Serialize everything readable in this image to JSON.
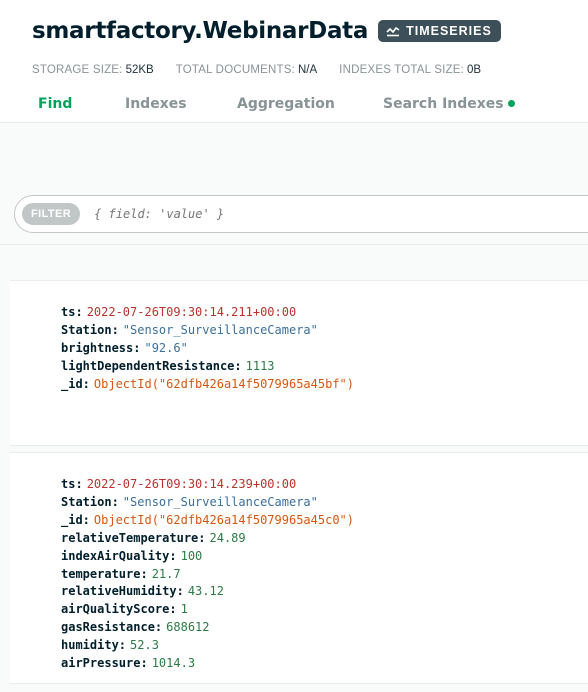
{
  "header": {
    "namespace": "smartfactory.WebinarData",
    "badge": "TIMESERIES",
    "stats": [
      {
        "label": "STORAGE SIZE:",
        "value": "52KB"
      },
      {
        "label": "TOTAL DOCUMENTS:",
        "value": "N/A"
      },
      {
        "label": "INDEXES TOTAL SIZE:",
        "value": "0B"
      }
    ]
  },
  "tabs": [
    {
      "label": "Find",
      "active": true
    },
    {
      "label": "Indexes"
    },
    {
      "label": "Aggregation"
    },
    {
      "label": "Search Indexes"
    }
  ],
  "query": {
    "filter_label": "FILTER",
    "placeholder": "{ field: 'value' }"
  },
  "documents": [
    {
      "fields": [
        {
          "key": "ts:",
          "value": "2022-07-26T09:30:14.211+00:00",
          "type": "date"
        },
        {
          "key": "Station:",
          "value": "\"Sensor_SurveillanceCamera\"",
          "type": "string"
        },
        {
          "key": "brightness:",
          "value": "\"92.6\"",
          "type": "string"
        },
        {
          "key": "lightDependentResistance:",
          "value": "1113",
          "type": "number"
        },
        {
          "key": "_id:",
          "value": "ObjectId(\"62dfb426a14f5079965a45bf\")",
          "type": "objectid"
        }
      ]
    },
    {
      "fields": [
        {
          "key": "ts:",
          "value": "2022-07-26T09:30:14.239+00:00",
          "type": "date"
        },
        {
          "key": "Station:",
          "value": "\"Sensor_SurveillanceCamera\"",
          "type": "string"
        },
        {
          "key": "_id:",
          "value": "ObjectId(\"62dfb426a14f5079965a45c0\")",
          "type": "objectid"
        },
        {
          "key": "relativeTemperature:",
          "value": "24.89",
          "type": "number"
        },
        {
          "key": "indexAirQuality:",
          "value": "100",
          "type": "number"
        },
        {
          "key": "temperature:",
          "value": "21.7",
          "type": "number"
        },
        {
          "key": "relativeHumidity:",
          "value": "43.12",
          "type": "number"
        },
        {
          "key": "airQualityScore:",
          "value": "1",
          "type": "number"
        },
        {
          "key": "gasResistance:",
          "value": "688612",
          "type": "number"
        },
        {
          "key": "humidity:",
          "value": "52.3",
          "type": "number"
        },
        {
          "key": "airPressure:",
          "value": "1014.3",
          "type": "number"
        }
      ]
    }
  ],
  "colors": {
    "accent": "#00a35c",
    "date": "#b8342d",
    "string": "#3b6f9a",
    "number": "#2d7a45",
    "objectid": "#d5570f"
  }
}
